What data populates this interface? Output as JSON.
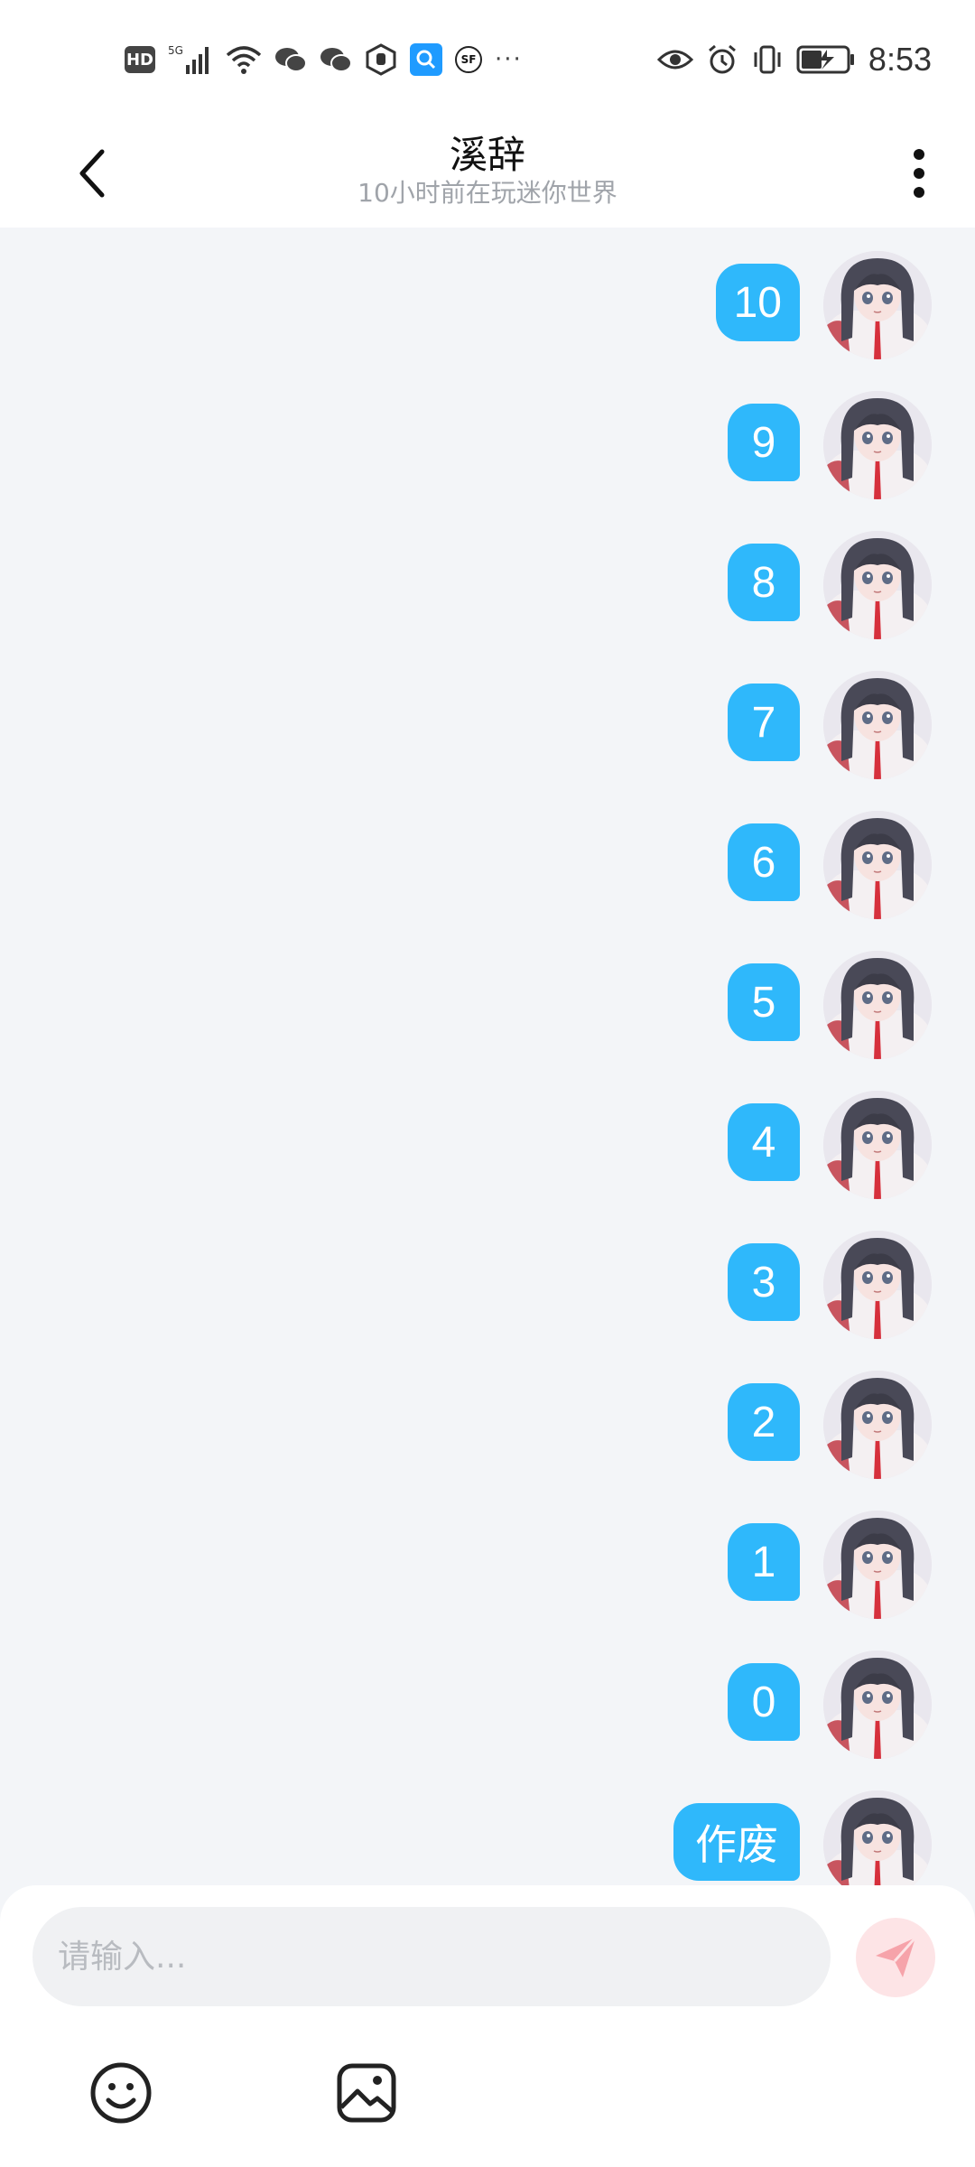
{
  "status_bar": {
    "hd_label": "HD",
    "network_label": "5G",
    "more_label": "···",
    "time": "8:53"
  },
  "header": {
    "title": "溪辞",
    "subtitle": "10小时前在玩迷你世界"
  },
  "messages": [
    {
      "text": "10"
    },
    {
      "text": "9"
    },
    {
      "text": "8"
    },
    {
      "text": "7"
    },
    {
      "text": "6"
    },
    {
      "text": "5"
    },
    {
      "text": "4"
    },
    {
      "text": "3"
    },
    {
      "text": "2"
    },
    {
      "text": "1"
    },
    {
      "text": "0"
    },
    {
      "text": "作废"
    }
  ],
  "input": {
    "placeholder": "请输入..."
  },
  "colors": {
    "bubble": "#2fb8fb",
    "background": "#f3f5f8",
    "send_button": "#fde4e6",
    "send_icon": "#f8a0a8"
  },
  "icons": {
    "back": "chevron-left-icon",
    "more": "more-vertical-icon",
    "send": "paper-plane-icon",
    "emoji": "smiley-icon",
    "image": "image-icon"
  }
}
